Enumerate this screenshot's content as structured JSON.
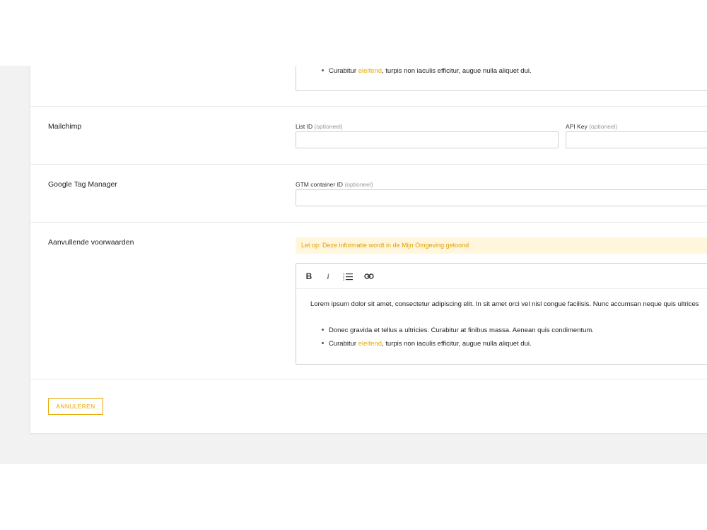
{
  "top_editor": {
    "bullet2_pre": "Curabitur ",
    "bullet2_link": "eleifend",
    "bullet2_post": ", turpis non iaculis efficitur, augue nulla aliquet dui."
  },
  "mailchimp": {
    "label": "Mailchimp",
    "list_id_label": "List ID",
    "list_id_optional": "(optioneel)",
    "list_id_value": "",
    "api_key_label": "API Key",
    "api_key_optional": "(optioneel)",
    "api_key_value": ""
  },
  "gtm": {
    "label": "Google Tag Manager",
    "container_label": "GTM container ID",
    "container_optional": "(optioneel)",
    "container_value": ""
  },
  "voorwaarden": {
    "label": "Aanvullende voorwaarden",
    "notice": "Let op: Deze informatie wordt in de Mijn Omgeving getoond",
    "toolbar": {
      "bold": "B",
      "italic": "i"
    },
    "paragraph": "Lorem ipsum dolor sit amet, consectetur adipiscing elit. In sit amet orci vel nisl congue facilisis. Nunc accumsan neque quis ultrices",
    "bullet1": "Donec gravida et tellus a ultricies. Curabitur at finibus massa. Aenean quis condimentum.",
    "bullet2_pre": "Curabitur ",
    "bullet2_link": "eleifend",
    "bullet2_post": ", turpis non iaculis efficitur, augue nulla aliquet dui."
  },
  "footer": {
    "cancel_label": "ANNULEREN"
  },
  "colors": {
    "accent": "#e8a800",
    "notice_bg": "#fff6dc",
    "page_bg": "#f2f2f2"
  }
}
